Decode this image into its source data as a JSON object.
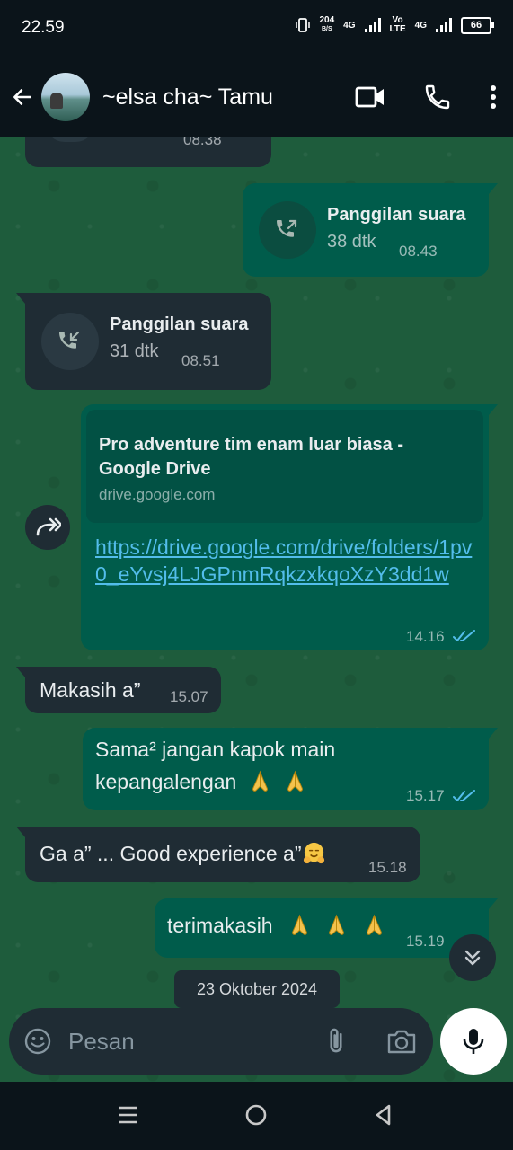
{
  "status_bar": {
    "time": "22.59",
    "net_speed_value": "204",
    "net_speed_unit": "B/S",
    "net1": "4G",
    "volte_top": "Vo",
    "volte_bottom": "LTE",
    "net2": "4G",
    "battery": "66"
  },
  "header": {
    "contact_name": "~elsa cha~ Tamu"
  },
  "messages": {
    "partial_time": "08.38",
    "call_out": {
      "title": "Panggilan suara",
      "duration": "38 dtk",
      "time": "08.43"
    },
    "call_in": {
      "title": "Panggilan suara",
      "duration": "31 dtk",
      "time": "08.51"
    },
    "link": {
      "preview_title": "Pro adventure tim enam luar biasa - Google Drive",
      "preview_domain": "drive.google.com",
      "url": "https://drive.google.com/drive/folders/1pv0_eYvsj4LJGPnmRqkzxkqoXzY3dd1w",
      "time": "14.16"
    },
    "m1": {
      "text": "Makasih a”",
      "time": "15.07"
    },
    "m2": {
      "line1": "Sama² jangan kapok main",
      "line2": "kepangalengan",
      "time": "15.17"
    },
    "m3": {
      "text": "Ga a” ... Good experience a”",
      "time": "15.18"
    },
    "m4": {
      "text": "terimakasih",
      "time": "15.19"
    },
    "date_chip": "23 Oktober 2024"
  },
  "input": {
    "placeholder": "Pesan"
  },
  "colors": {
    "chat_bg": "#1e5c3c",
    "incoming_bubble": "#1f2c34",
    "outgoing_bubble": "#005c4b",
    "link": "#53bdeb",
    "read_ticks": "#53bdeb"
  },
  "icons": [
    "back-arrow-icon",
    "video-call-icon",
    "phone-icon",
    "more-vert-icon",
    "outgoing-call-icon",
    "incoming-call-icon",
    "forward-icon",
    "double-check-icon",
    "folded-hands-emoji",
    "hugging-face-emoji",
    "chevron-double-down-icon",
    "emoji-icon",
    "attach-icon",
    "camera-icon",
    "mic-icon",
    "nav-menu-icon",
    "nav-home-icon",
    "nav-back-icon"
  ]
}
